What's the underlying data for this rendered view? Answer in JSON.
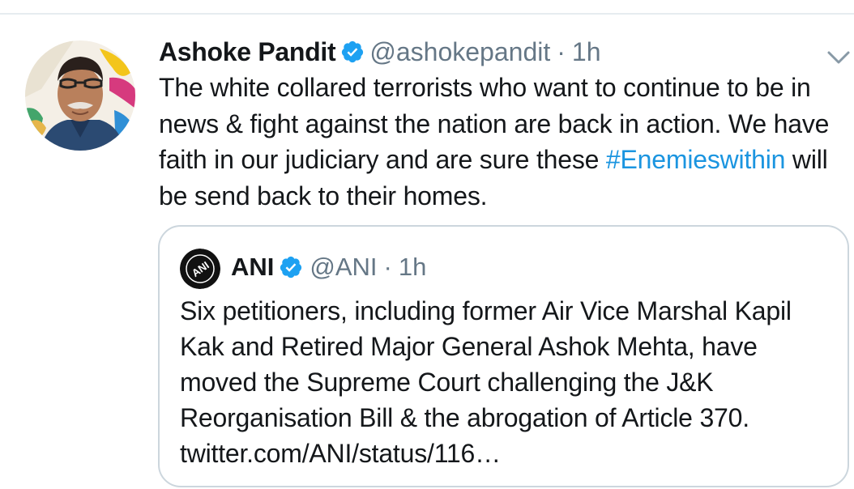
{
  "tweet": {
    "display_name": "Ashoke Pandit",
    "handle": "@ashokepandit",
    "separator": "·",
    "time": "1h",
    "verified_icon": "verified-badge-icon",
    "menu_icon": "chevron-down-icon",
    "text_before_hashtag": "The white collared terrorists who want to continue to be in news & fight against the nation are back in action. We have faith in our judiciary and are sure these ",
    "hashtag": "#Enemieswithin",
    "text_after_hashtag": " will be send back to their homes."
  },
  "quoted_tweet": {
    "display_name": "ANI",
    "handle": "@ANI",
    "separator": "·",
    "time": "1h",
    "avatar_logo_text": "ANI",
    "text": "Six petitioners, including former Air Vice Marshal Kapil Kak and Retired Major General Ashok Mehta, have moved the Supreme Court challenging the J&K Reorganisation Bill & the abrogation of Article 370.",
    "link": "twitter.com/ANI/status/116…"
  },
  "colors": {
    "text": "#14171a",
    "secondary_text": "#657786",
    "link_blue": "#1b95e0",
    "verified_blue": "#1da1f2",
    "card_border": "#ccd6dd"
  }
}
